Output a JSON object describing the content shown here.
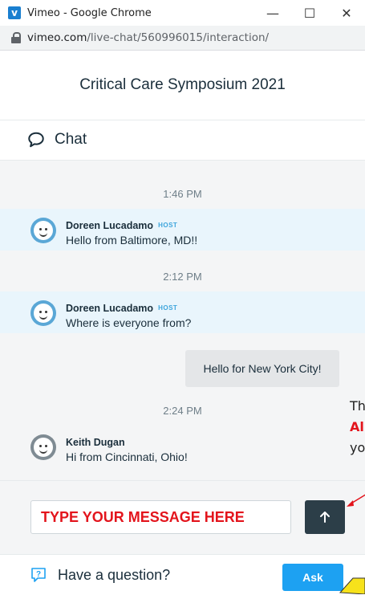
{
  "window": {
    "title": "Vimeo - Google Chrome",
    "logo_letter": "v",
    "minimize": "—",
    "maximize": "☐",
    "close": "✕"
  },
  "address": {
    "host": "vimeo.com",
    "path": "/live-chat/560996015/interaction/"
  },
  "event": {
    "title": "Critical Care Symposium 2021"
  },
  "chat": {
    "header": "Chat"
  },
  "messages": {
    "ts1": "1:46 PM",
    "m1": {
      "name": "Doreen Lucadamo",
      "badge": "HOST",
      "text": "Hello from Baltimore, MD!!"
    },
    "ts2": "2:12 PM",
    "m2": {
      "name": "Doreen Lucadamo",
      "badge": "HOST",
      "text": "Where is everyone from?"
    },
    "own": "Hello for New York City!",
    "ts3": "2:24 PM",
    "m3": {
      "name": "Keith Dugan",
      "text": "Hi from Cincinnati, Ohio!"
    }
  },
  "annotation": {
    "line1": "Th",
    "line2": "Al",
    "line3": "yo",
    "color_accent": "#e3141c"
  },
  "input": {
    "placeholder": "TYPE YOUR MESSAGE HERE",
    "send_icon": "arrow-up-icon"
  },
  "question": {
    "label": "Have a question?",
    "ask_button": "Ask"
  },
  "colors": {
    "host_bg": "#e9f5fc",
    "ask_blue": "#1da1f2",
    "send_dark": "#2c3e48"
  }
}
